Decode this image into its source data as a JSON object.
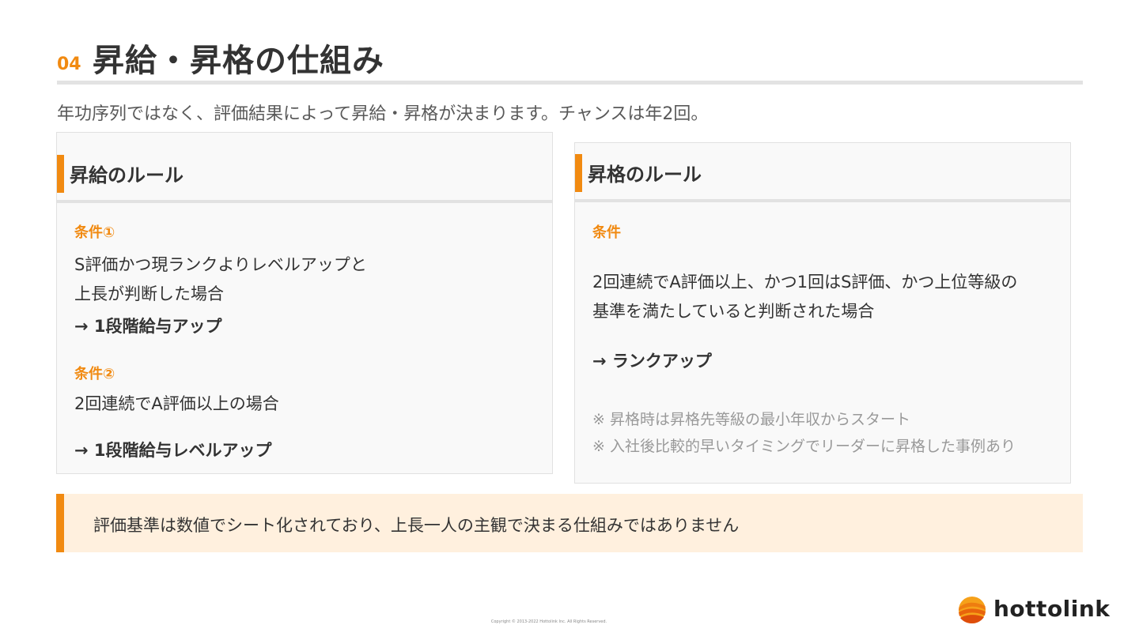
{
  "header": {
    "section_no": "04",
    "title": "昇給・昇格の仕組み",
    "subtitle": "年功序列ではなく、評価結果によって昇給・昇格が決まります。チャンスは年2回。"
  },
  "raise_card": {
    "title": "昇給のルール",
    "cond1_label": "条件①",
    "cond1_line1": "S評価かつ現ランクよりレベルアップと",
    "cond1_line2": "上長が判断した場合",
    "cond1_result": "→ 1段階給与アップ",
    "cond2_label": "条件②",
    "cond2_text": "2回連続でA評価以上の場合",
    "cond2_result": "→ 1段階給与レベルアップ"
  },
  "promotion_card": {
    "title": "昇格のルール",
    "cond_label": "条件",
    "cond_line1": "2回連続でA評価以上、かつ1回はS評価、かつ上位等級の",
    "cond_line2": "基準を満たしていると判断された場合",
    "result": "→ ランクアップ",
    "note1": "※ 昇格時は昇格先等級の最小年収からスタート",
    "note2": "※ 入社後比較的早いタイミングでリーダーに昇格した事例あり"
  },
  "banner": {
    "text": "評価基準は数値でシート化されており、上長一人の主観で決まる仕組みではありません"
  },
  "footer": {
    "copyright": "Copyright © 2013-2022 Hottolink Inc. All Rights Reserved.",
    "logo_text": "hottolink",
    "logo_icon": "hottolink-flame-logo-icon"
  },
  "colors": {
    "accent": "#f18a11",
    "banner_bg": "#fff0de",
    "card_bg": "#f9f9f9",
    "note_text": "#999999"
  }
}
